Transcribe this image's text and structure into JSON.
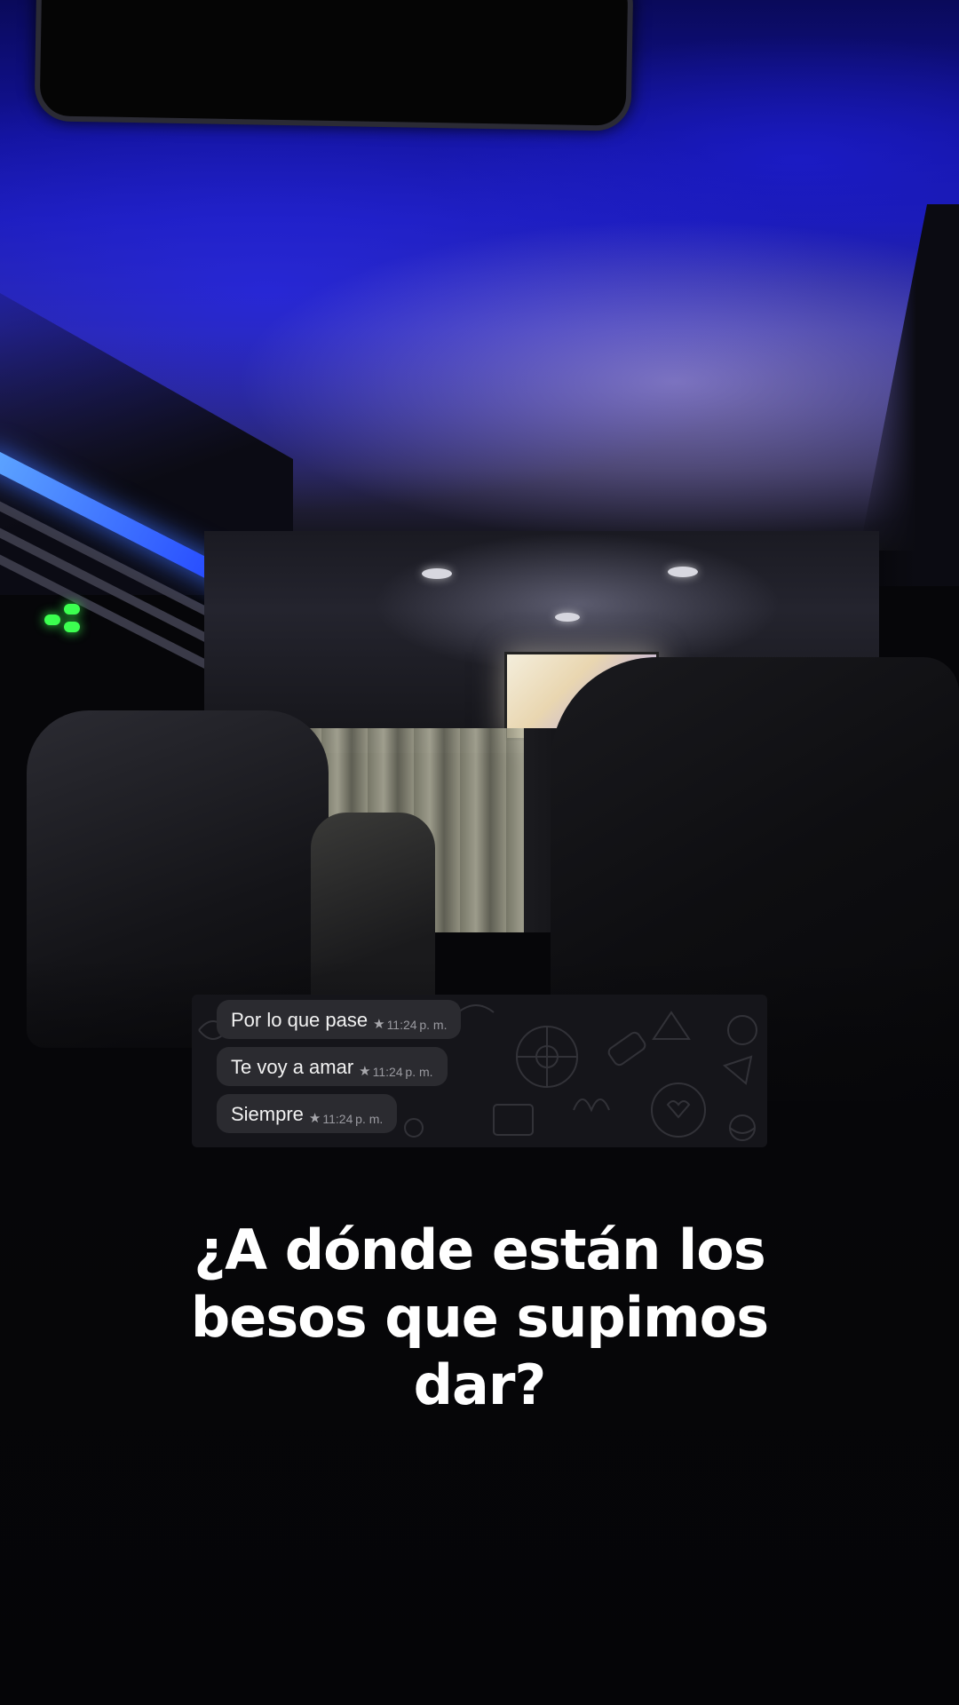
{
  "messages": [
    {
      "text": "Por lo que pase",
      "icon": "star-icon",
      "time": "11:24 p. m."
    },
    {
      "text": "Te voy a amar",
      "icon": "star-icon",
      "time": "11:24 p. m."
    },
    {
      "text": "Siempre",
      "icon": "star-icon",
      "time": "11:24 p. m."
    }
  ],
  "caption": {
    "lines": [
      "¿A dónde están los",
      "besos que supimos",
      "dar?"
    ]
  },
  "colors": {
    "ceiling_light": "#1a1ab0",
    "bubble": "#2b2b30",
    "caption": "#ffffff",
    "accent_green": "#3cff50"
  }
}
